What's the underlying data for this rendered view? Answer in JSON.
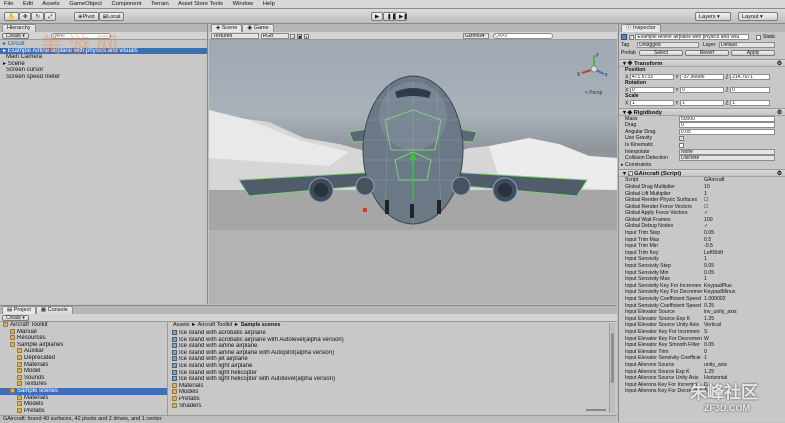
{
  "menu": {
    "items": [
      "File",
      "Edit",
      "Assets",
      "GameObject",
      "Component",
      "Terrain",
      "Asset Store Tools",
      "Window",
      "Help"
    ]
  },
  "toolbar": {
    "pivot": "Pivot",
    "local": "Local",
    "layers": "Layers",
    "layout": "Layout"
  },
  "hierarchy": {
    "title": "Hierarchy",
    "create": "Create",
    "search_placeholder": "Q▾All",
    "items": [
      "Circuit",
      "Example Airline airplane with physics and visuals",
      "Main Camera",
      "Scene",
      "Screen cursor",
      "Screen speed meter"
    ]
  },
  "scene_view": {
    "tabs": [
      "Scene",
      "Game"
    ],
    "shading": "Textured",
    "render": "RGB",
    "gizmos": "Gizmos",
    "search": "Q▾All",
    "persp": "< Persp",
    "axis_labels": {
      "y": "y",
      "x": "X",
      "z": "z"
    }
  },
  "project": {
    "tabs": [
      "Project",
      "Console"
    ],
    "create": "Create",
    "tree": [
      {
        "label": "Aircraft Toolkit",
        "depth": 0
      },
      {
        "label": "Manual",
        "depth": 1
      },
      {
        "label": "Resources",
        "depth": 1
      },
      {
        "label": "Sample airplanes",
        "depth": 1
      },
      {
        "label": "Auxiliar",
        "depth": 2
      },
      {
        "label": "Deprecated",
        "depth": 2
      },
      {
        "label": "Materials",
        "depth": 2
      },
      {
        "label": "Model",
        "depth": 2
      },
      {
        "label": "Sounds",
        "depth": 2
      },
      {
        "label": "Textures",
        "depth": 2
      },
      {
        "label": "Sample scenes",
        "depth": 1
      },
      {
        "label": "Materials",
        "depth": 2
      },
      {
        "label": "Models",
        "depth": 2
      },
      {
        "label": "Prefabs",
        "depth": 2
      }
    ],
    "breadcrumb": {
      "root": "Assets",
      "sep": "►",
      "mid": "Aircraft Toolkit",
      "cur": "Sample scenes"
    },
    "files": [
      "Ice island with acrobatic airplane",
      "Ice island with acrobatic airplane with Autolevel(alpha version)",
      "Ice island with airline airplane",
      "Ice island with airline airplane with Autopilot(alpha version)",
      "Ice island with jet airplane",
      "Ice island with light airplane",
      "Ice island with light helicopter",
      "Ice island with light helicopter with Autolevel(alpha version)"
    ],
    "folders": [
      "Materials",
      "Models",
      "Prefabs",
      "Shaders"
    ]
  },
  "status_bar": "GAircraft: found 40 surfaces, 42 pivots and 2 drives, and 1 center",
  "inspector": {
    "title": "Inspector",
    "object_name": "Example Airline airplane with physics and visu",
    "static": "Static",
    "tag_label": "Tag",
    "tag_value": "Untagged",
    "layer_label": "Layer",
    "layer_value": "Default",
    "prefab_label": "Prefab",
    "prefab_select": "Select",
    "prefab_revert": "Revert",
    "prefab_apply": "Apply",
    "transform": {
      "title": "Transform",
      "position": {
        "label": "Position",
        "x": "471.5733",
        "y": "-37.90686",
        "z": "214.7071"
      },
      "rotation": {
        "label": "Rotation",
        "x": "0",
        "y": "0",
        "z": "0"
      },
      "scale": {
        "label": "Scale",
        "x": "1",
        "y": "1",
        "z": "1"
      }
    },
    "rigidbody": {
      "title": "Rigidbody",
      "props": [
        {
          "label": "Mass",
          "value": "50000",
          "type": "field"
        },
        {
          "label": "Drag",
          "value": "0",
          "type": "field"
        },
        {
          "label": "Angular Drag",
          "value": "0.05",
          "type": "field"
        },
        {
          "label": "Use Gravity",
          "value": "✓",
          "type": "check"
        },
        {
          "label": "Is Kinematic",
          "value": "",
          "type": "check"
        },
        {
          "label": "Interpolate",
          "value": "None",
          "type": "field"
        },
        {
          "label": "Collision Detection",
          "value": "Discrete",
          "type": "field"
        }
      ],
      "constraints": "Constraints"
    },
    "script": {
      "title": "GAircraft (Script)",
      "props": [
        {
          "label": "Script",
          "value": "GAircraft"
        },
        {
          "label": "Global Drag Multiplier",
          "value": "10"
        },
        {
          "label": "Global Lift Multiplier",
          "value": "1"
        },
        {
          "label": "Global Render Physic Surfaces",
          "value": "☐"
        },
        {
          "label": "Global Render Force Vectors",
          "value": "☐"
        },
        {
          "label": "Global Apply Force Vectors",
          "value": "✓"
        },
        {
          "label": "Global Wait Frames",
          "value": "100"
        },
        {
          "label": "Global Debug Nodes",
          "value": "✓"
        },
        {
          "label": "Input Trim Step",
          "value": "0.05"
        },
        {
          "label": "Input Trim Max",
          "value": "0.5"
        },
        {
          "label": "Input Trim Min",
          "value": "-0.5"
        },
        {
          "label": "Input Trim Key",
          "value": "LeftShift"
        },
        {
          "label": "Input Sensivity",
          "value": "1"
        },
        {
          "label": "Input Sensivity Step",
          "value": "0.05"
        },
        {
          "label": "Input Sensivity Min",
          "value": "0.05"
        },
        {
          "label": "Input Sensivity Max",
          "value": "1"
        },
        {
          "label": "Input Sensivity Key For Incremen",
          "value": "KeypadPlus"
        },
        {
          "label": "Input Sensivity Key For Decremer",
          "value": "KeypadMinus"
        },
        {
          "label": "Input Sensivity Coefficient Speed",
          "value": "1.000002"
        },
        {
          "label": "Input Sensivity Coefficient Speed",
          "value": "0.25"
        },
        {
          "label": "Input Elevator Source",
          "value": "inv_unity_axis"
        },
        {
          "label": "Input Elevator Source Exp K",
          "value": "1.25"
        },
        {
          "label": "Input Elevator Source Unity Axis",
          "value": "Vertical"
        },
        {
          "label": "Input Elevator Key For Incremen",
          "value": "S"
        },
        {
          "label": "Input Elevator Key For Decremen",
          "value": "W"
        },
        {
          "label": "Input Elevator Key Smooth Filter",
          "value": "0.05"
        },
        {
          "label": "Input Elevator Trim",
          "value": "0"
        },
        {
          "label": "Input Elevator Sensivity Coefficie",
          "value": "1"
        },
        {
          "label": "Input Ailerons Source",
          "value": "unity_axis"
        },
        {
          "label": "Input Ailerons Source Exp K",
          "value": "1.25"
        },
        {
          "label": "Input Ailerons Source Unity Axis",
          "value": "Horizontal"
        },
        {
          "label": "Input Ailerons Key For Incremen",
          "value": "D"
        },
        {
          "label": "Input Ailerons Key For Decremen",
          "value": "A"
        }
      ]
    }
  },
  "watermark": {
    "top_left": "美游网",
    "bottom_right": "朱峰社区",
    "bottom_url": "ZF3D.COM"
  }
}
